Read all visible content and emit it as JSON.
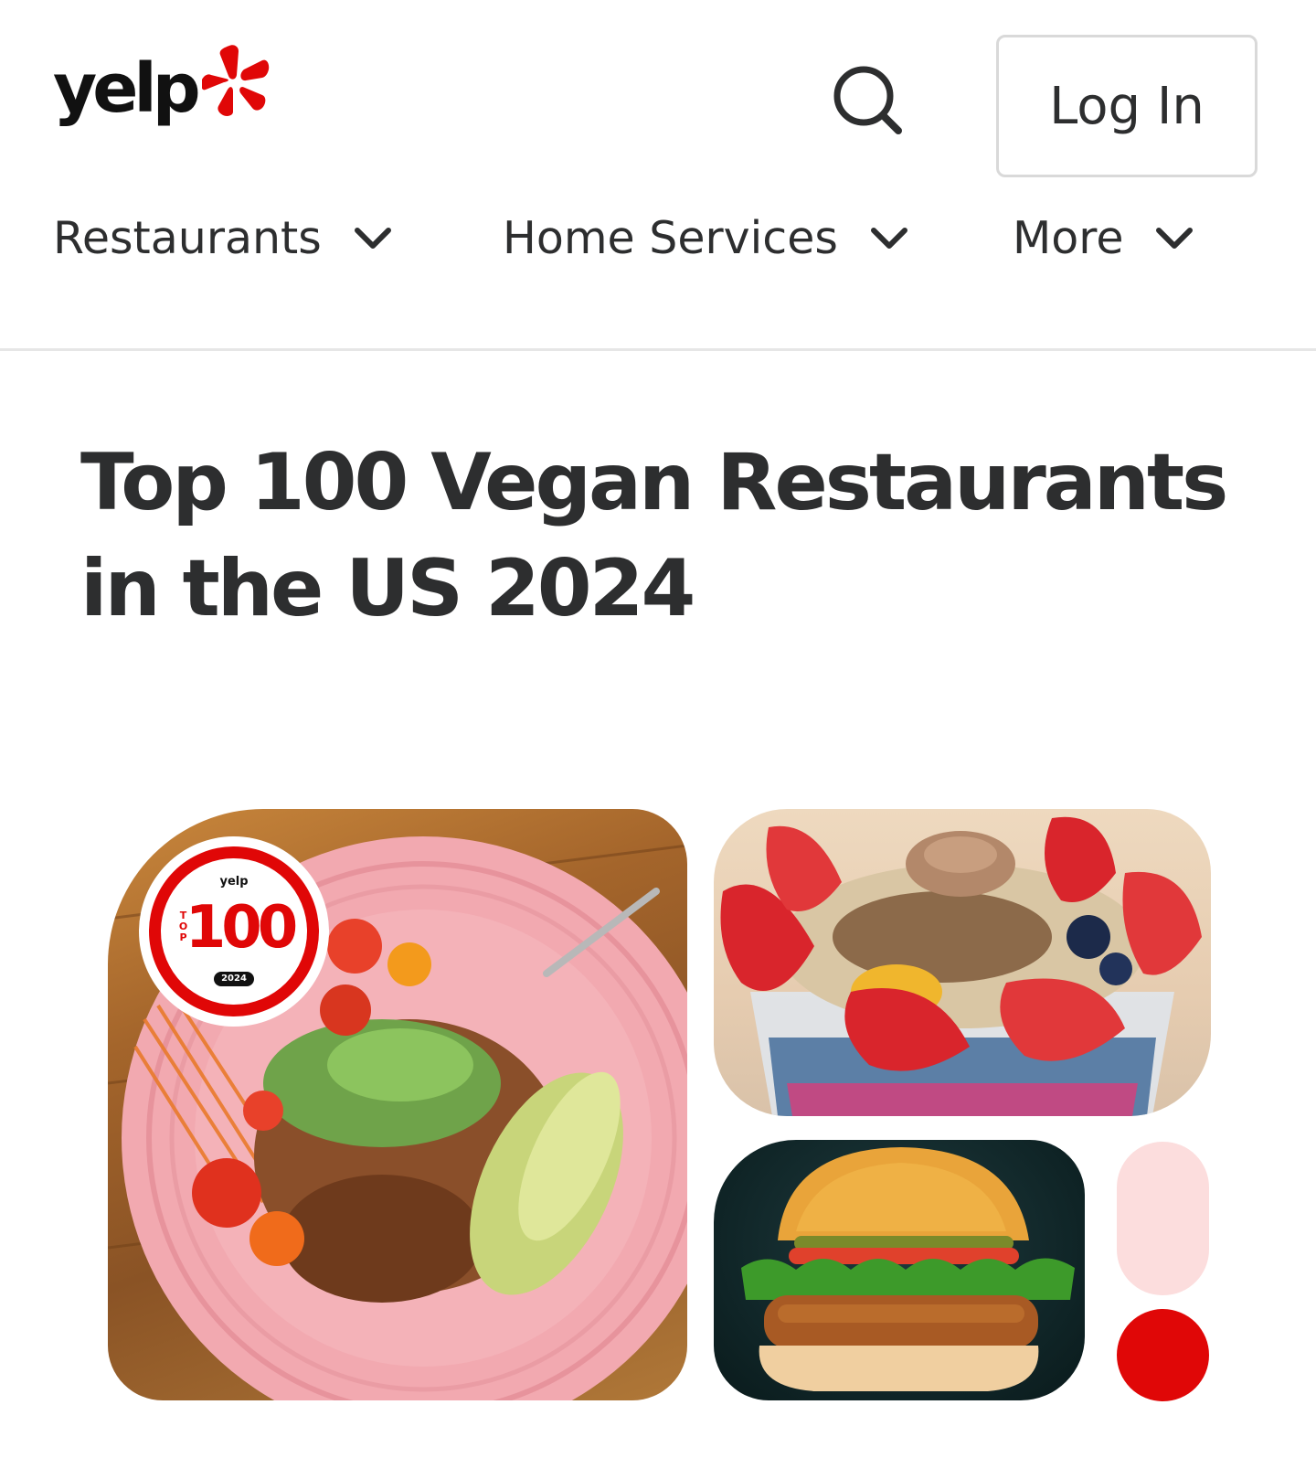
{
  "header": {
    "logo_text": "yelp",
    "search_icon": "search-icon",
    "login_label": "Log In"
  },
  "nav": {
    "items": [
      {
        "label": "Restaurants",
        "icon": "chevron-down-icon"
      },
      {
        "label": "Home Services",
        "icon": "chevron-down-icon"
      },
      {
        "label": "More",
        "icon": "chevron-down-icon"
      }
    ]
  },
  "main": {
    "title_line1": "Top 100 Vegan Restaurants",
    "title_line2": "in the US 2024"
  },
  "badge": {
    "brand": "yelp",
    "number": "100",
    "top_text": "TOP",
    "year": "2024"
  },
  "colors": {
    "brand_red": "#e00707",
    "text_dark": "#2d2e2f",
    "pill_pink": "#fcdddd",
    "border_gray": "#d9d9d9"
  }
}
